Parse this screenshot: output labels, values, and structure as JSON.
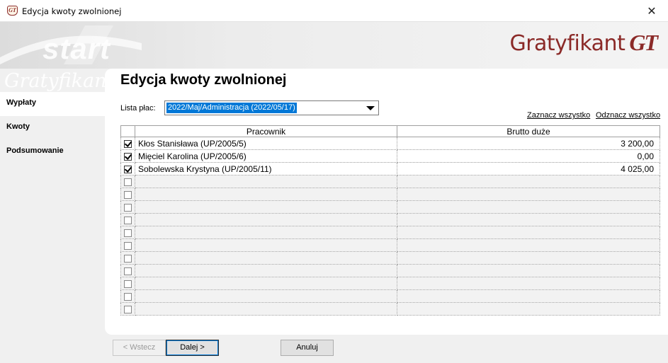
{
  "window": {
    "title": "Edycja kwoty zwolnionej",
    "close": "✕",
    "icon_text": "GT"
  },
  "banner": {
    "deco": "start",
    "brand_name": "Gratyfikant",
    "brand_mark": "GT"
  },
  "sidebar": {
    "deco": "Gratyfikant",
    "items": [
      {
        "label": "Wypłaty",
        "active": true
      },
      {
        "label": "Kwoty",
        "active": false
      },
      {
        "label": "Podsumowanie",
        "active": false
      }
    ]
  },
  "main": {
    "heading": "Edycja kwoty zwolnionej",
    "payroll_label": "Lista płac:",
    "payroll_value": "2022/Maj/Administracja (2022/05/17)",
    "select_all": "Zaznacz wszystko",
    "deselect_all": "Odznacz wszystko"
  },
  "table": {
    "columns": [
      "Pracownik",
      "Brutto duże"
    ],
    "rows": [
      {
        "checked": true,
        "name": "Kłos Stanisława (UP/2005/5)",
        "amount": "3 200,00"
      },
      {
        "checked": true,
        "name": "Mięciel Karolina (UP/2005/6)",
        "amount": "0,00"
      },
      {
        "checked": true,
        "name": "Sobolewska Krystyna (UP/2005/11)",
        "amount": "4 025,00"
      }
    ],
    "empty_rows": 11
  },
  "buttons": {
    "back": "< Wstecz",
    "next": "Dalej >",
    "cancel": "Anuluj"
  },
  "colors": {
    "brand": "#8b2a28",
    "selection": "#0078d7"
  }
}
